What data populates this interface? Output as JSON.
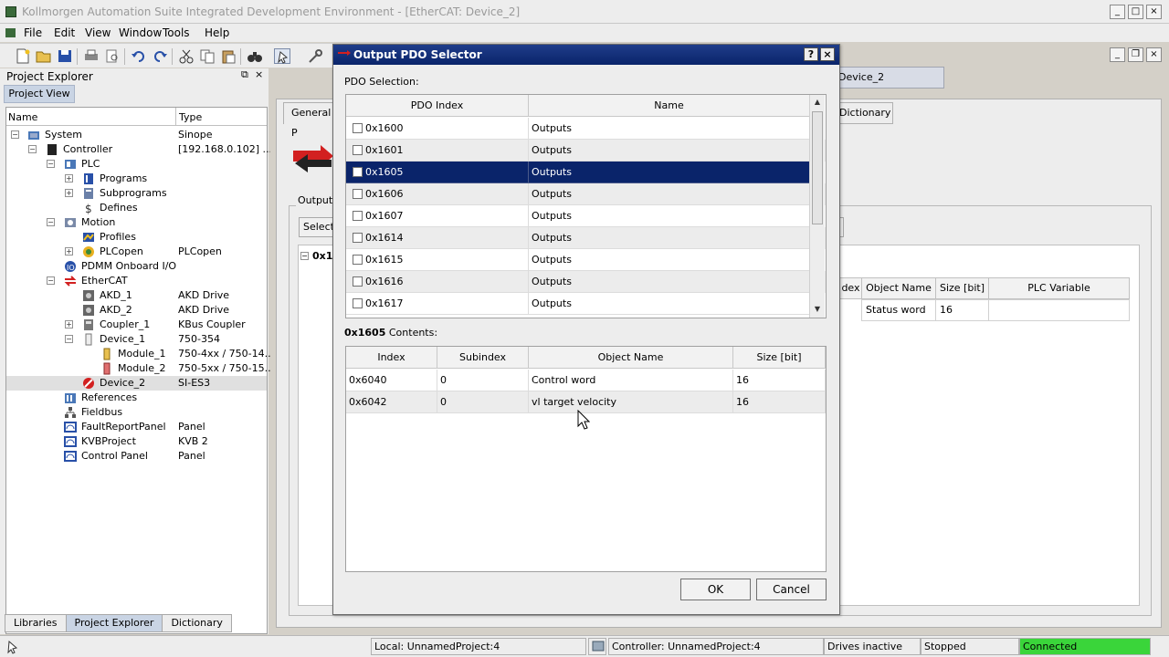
{
  "window": {
    "title": "Kollmorgen Automation Suite Integrated Development Environment - [EtherCAT: Device_2]",
    "controls": [
      "_",
      "□",
      "×"
    ],
    "inner_controls": [
      "_",
      "❐",
      "×"
    ]
  },
  "menu": [
    "File",
    "Edit",
    "View",
    "Window",
    "Tools",
    "Help"
  ],
  "explorer": {
    "title": "Project Explorer",
    "pin": "⧉",
    "close": "×",
    "view_tab": "Project View",
    "col_name": "Name",
    "col_type": "Type",
    "rows": [
      {
        "name": "System",
        "type": "Sinope"
      },
      {
        "name": "Controller",
        "type": "[192.168.0.102] ..."
      },
      {
        "name": "PLC",
        "type": ""
      },
      {
        "name": "Programs",
        "type": ""
      },
      {
        "name": "Subprograms",
        "type": ""
      },
      {
        "name": "Defines",
        "type": ""
      },
      {
        "name": "Motion",
        "type": ""
      },
      {
        "name": "Profiles",
        "type": ""
      },
      {
        "name": "PLCopen",
        "type": "PLCopen"
      },
      {
        "name": "PDMM Onboard I/O",
        "type": ""
      },
      {
        "name": "EtherCAT",
        "type": ""
      },
      {
        "name": "AKD_1",
        "type": "AKD Drive"
      },
      {
        "name": "AKD_2",
        "type": "AKD Drive"
      },
      {
        "name": "Coupler_1",
        "type": "KBus Coupler"
      },
      {
        "name": "Device_1",
        "type": "750-354"
      },
      {
        "name": "Module_1",
        "type": "750-4xx / 750-14..."
      },
      {
        "name": "Module_2",
        "type": "750-5xx / 750-15..."
      },
      {
        "name": "Device_2",
        "type": "SI-ES3"
      },
      {
        "name": "References",
        "type": ""
      },
      {
        "name": "Fieldbus",
        "type": ""
      },
      {
        "name": "FaultReportPanel",
        "type": "Panel"
      },
      {
        "name": "KVBProject",
        "type": "KVB 2"
      },
      {
        "name": "Control Panel",
        "type": "Panel"
      }
    ],
    "bottom_tabs": [
      "Libraries",
      "Project Explorer",
      "Dictionary"
    ]
  },
  "editor": {
    "doc_tab": "Device_2",
    "general_tab": "General P",
    "dictionary_tab": "Dictionary",
    "output_group": "Output",
    "select_btn": "Select",
    "collapse_label": "0x1",
    "bg_table": {
      "headers": [
        "dex",
        "Object Name",
        "Size [bit]",
        "PLC Variable"
      ],
      "row": [
        "",
        "Status word",
        "16",
        ""
      ]
    }
  },
  "dialog": {
    "title": "Output PDO Selector",
    "help": "?",
    "close": "×",
    "pdo_selection_label": "PDO Selection:",
    "pdo_headers": [
      "PDO Index",
      "Name"
    ],
    "pdo_rows": [
      {
        "index": "0x1600",
        "name": "Outputs"
      },
      {
        "index": "0x1601",
        "name": "Outputs"
      },
      {
        "index": "0x1605",
        "name": "Outputs"
      },
      {
        "index": "0x1606",
        "name": "Outputs"
      },
      {
        "index": "0x1607",
        "name": "Outputs"
      },
      {
        "index": "0x1614",
        "name": "Outputs"
      },
      {
        "index": "0x1615",
        "name": "Outputs"
      },
      {
        "index": "0x1616",
        "name": "Outputs"
      },
      {
        "index": "0x1617",
        "name": "Outputs"
      }
    ],
    "selected_pdo": "0x1605",
    "contents_bold": "0x1605",
    "contents_suffix": " Contents:",
    "content_headers": [
      "Index",
      "Subindex",
      "Object Name",
      "Size [bit]"
    ],
    "content_rows": [
      [
        "0x6040",
        "0",
        "Control word",
        "16"
      ],
      [
        "0x6042",
        "0",
        "vl target velocity",
        "16"
      ]
    ],
    "ok": "OK",
    "cancel": "Cancel"
  },
  "status": {
    "local": "Local: UnnamedProject:4",
    "controller": "Controller: UnnamedProject:4",
    "drives": "Drives inactive",
    "state": "Stopped",
    "connection": "Connected",
    "connection_color": "#3ad53a"
  },
  "colors": {
    "selection": "#0a246a",
    "accent_red": "#d22020"
  }
}
